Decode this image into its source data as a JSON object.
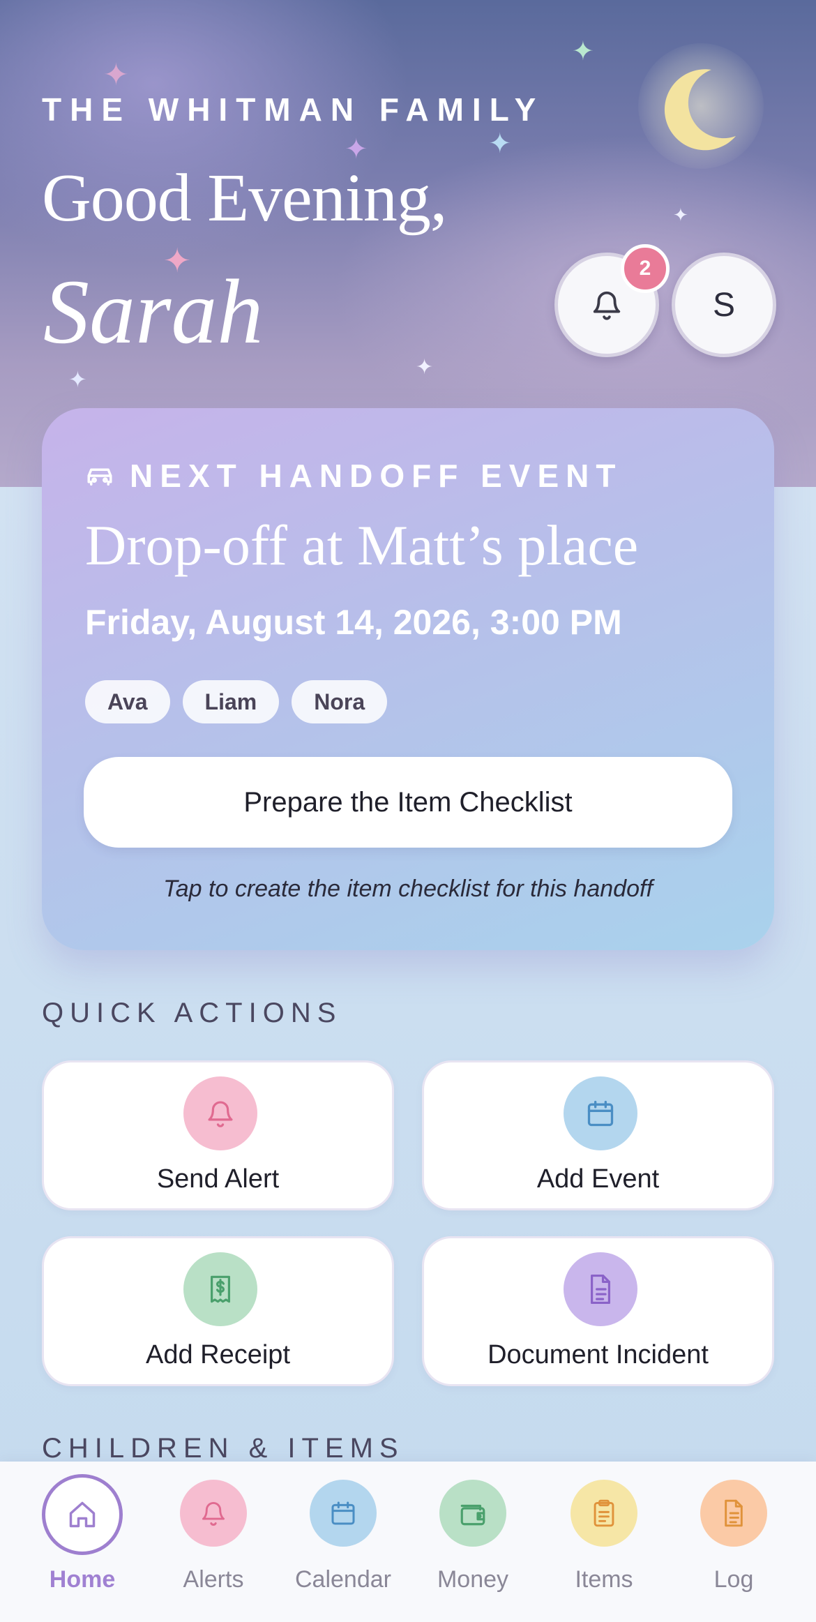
{
  "header": {
    "family_name": "THE WHITMAN FAMILY",
    "greeting": "Good Evening,",
    "user_name": "Sarah",
    "notifications_count": "2",
    "avatar_initial": "S",
    "icons": [
      "moon-icon",
      "bell-icon"
    ]
  },
  "handoff": {
    "label": "NEXT HANDOFF EVENT",
    "icon": "car-icon",
    "title": "Drop-off at Matt’s place",
    "datetime": "Friday, August 14, 2026, 3:00 PM",
    "children": [
      "Ava",
      "Liam",
      "Nora"
    ],
    "button_label": "Prepare the Item Checklist",
    "hint": "Tap to create the item checklist for this handoff"
  },
  "quick_actions": {
    "title": "QUICK ACTIONS",
    "items": [
      {
        "label": "Send Alert",
        "icon": "bell-icon",
        "color": "#f6bdd0"
      },
      {
        "label": "Add Event",
        "icon": "calendar-icon",
        "color": "#b3d6ee"
      },
      {
        "label": "Add Receipt",
        "icon": "receipt-icon",
        "color": "#b9e0c6"
      },
      {
        "label": "Document Incident",
        "icon": "document-icon",
        "color": "#c9b6ec"
      }
    ]
  },
  "children_items": {
    "title": "CHILDREN & ITEMS"
  },
  "nav": {
    "items": [
      {
        "label": "Home",
        "icon": "home-icon",
        "color": "#ffffff",
        "active": true
      },
      {
        "label": "Alerts",
        "icon": "bell-icon",
        "color": "#f6bdd0"
      },
      {
        "label": "Calendar",
        "icon": "calendar-icon",
        "color": "#b3d6ee"
      },
      {
        "label": "Money",
        "icon": "wallet-icon",
        "color": "#b9e0c6"
      },
      {
        "label": "Items",
        "icon": "clipboard-icon",
        "color": "#f6e6a6"
      },
      {
        "label": "Log",
        "icon": "document-icon",
        "color": "#fbcaa6"
      }
    ]
  }
}
